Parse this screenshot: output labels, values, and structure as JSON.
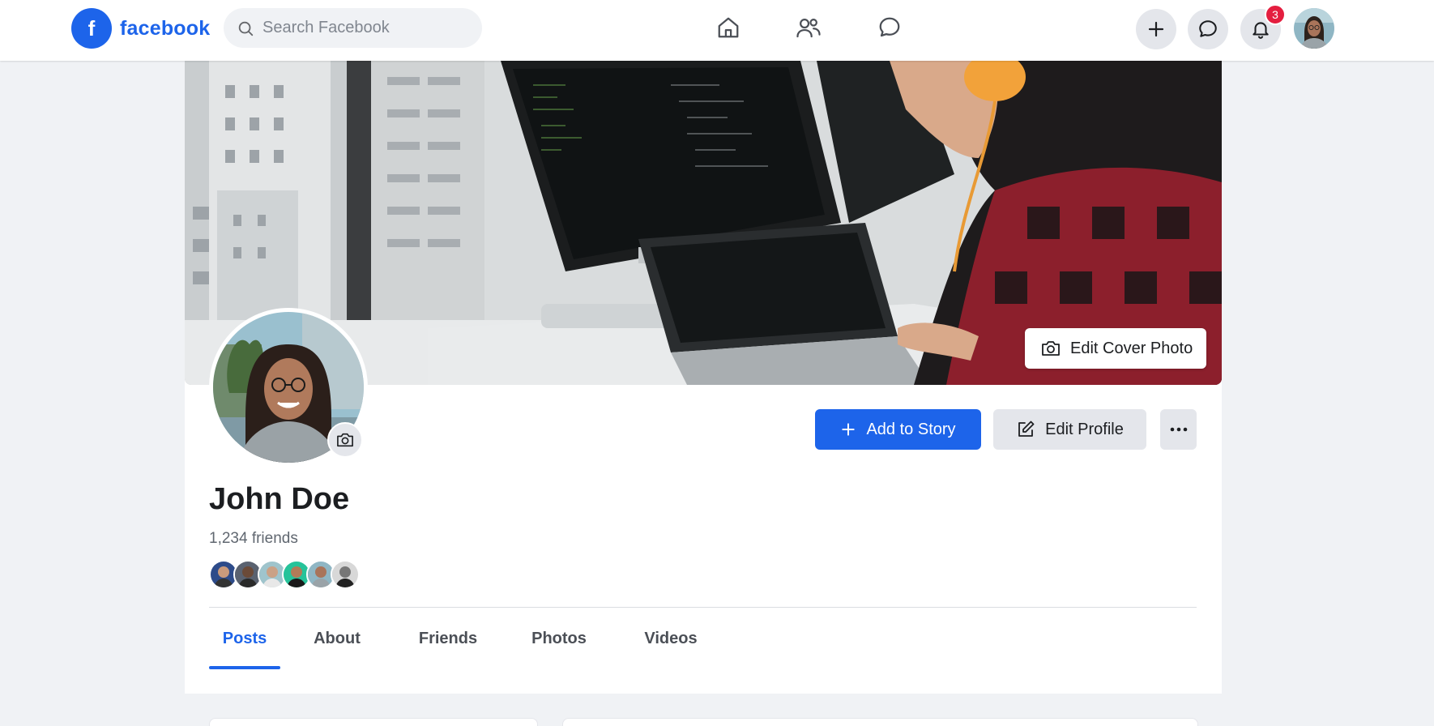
{
  "brand": {
    "logo_letter": "f",
    "name": "facebook",
    "color": "#1d64ea"
  },
  "search": {
    "placeholder": "Search Facebook",
    "value": ""
  },
  "nav": {
    "center_icons": [
      "home-icon",
      "friends-icon",
      "messenger-icon"
    ],
    "right_icons": [
      "plus-icon",
      "messenger-icon",
      "bell-icon"
    ],
    "notification_count": "3"
  },
  "profile": {
    "name": "John Doe",
    "friends_count": "1,234 friends",
    "edit_cover_label": "Edit Cover Photo",
    "add_story_label": "Add to Story",
    "edit_profile_label": "Edit Profile",
    "more_label": "···"
  },
  "tabs": [
    {
      "label": "Posts",
      "active": true
    },
    {
      "label": "About",
      "active": false
    },
    {
      "label": "Friends",
      "active": false
    },
    {
      "label": "Photos",
      "active": false
    },
    {
      "label": "Videos",
      "active": false
    }
  ],
  "colors": {
    "accent": "#1d64ea",
    "badge": "#e41e3f",
    "page_bg": "#f0f2f5"
  }
}
